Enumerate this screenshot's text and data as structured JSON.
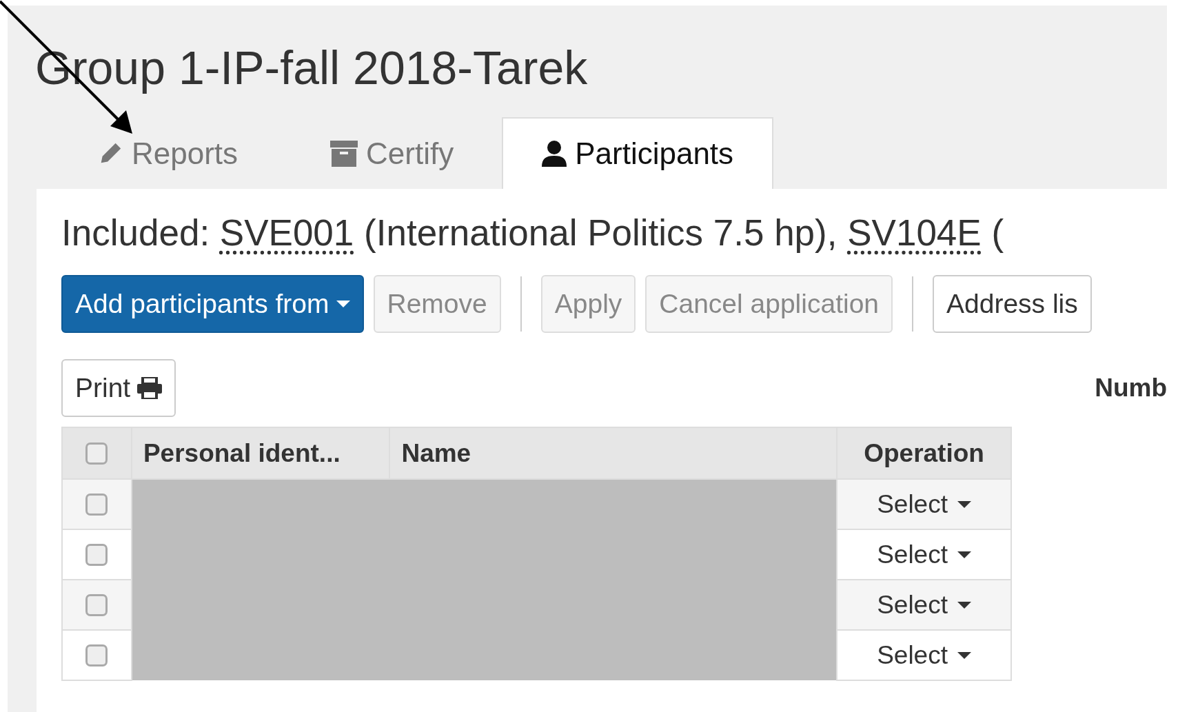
{
  "title": "Group 1-IP-fall 2018-Tarek",
  "tabs": [
    {
      "label": "Reports",
      "kind": "pencil",
      "selected": false
    },
    {
      "label": "Certify",
      "kind": "archive",
      "selected": false
    },
    {
      "label": "Participants",
      "kind": "user",
      "selected": true
    }
  ],
  "included": {
    "label": "Included:",
    "courses": [
      {
        "code": "SVE001",
        "title": "(International Politics 7.5 hp),"
      },
      {
        "code": "SV104E",
        "title": "("
      }
    ]
  },
  "toolbar": [
    {
      "kind": "primary-dropdown",
      "label": "Add participants from",
      "disabled": false
    },
    {
      "kind": "button",
      "label": "Remove",
      "disabled": true
    },
    {
      "kind": "separator"
    },
    {
      "kind": "button",
      "label": "Apply",
      "disabled": true
    },
    {
      "kind": "button",
      "label": "Cancel application",
      "disabled": true
    },
    {
      "kind": "separator"
    },
    {
      "kind": "button",
      "label": "Address lis",
      "disabled": false
    }
  ],
  "print_button": {
    "label": "Print"
  },
  "number_label": "Numb",
  "table": {
    "header_checked": false,
    "columns": [
      "Personal ident...",
      "Name",
      "Operation"
    ],
    "rows": [
      {
        "checked": false,
        "operation": "Select"
      },
      {
        "checked": false,
        "operation": "Select"
      },
      {
        "checked": false,
        "operation": "Select"
      },
      {
        "checked": false,
        "operation": "Select"
      }
    ]
  }
}
